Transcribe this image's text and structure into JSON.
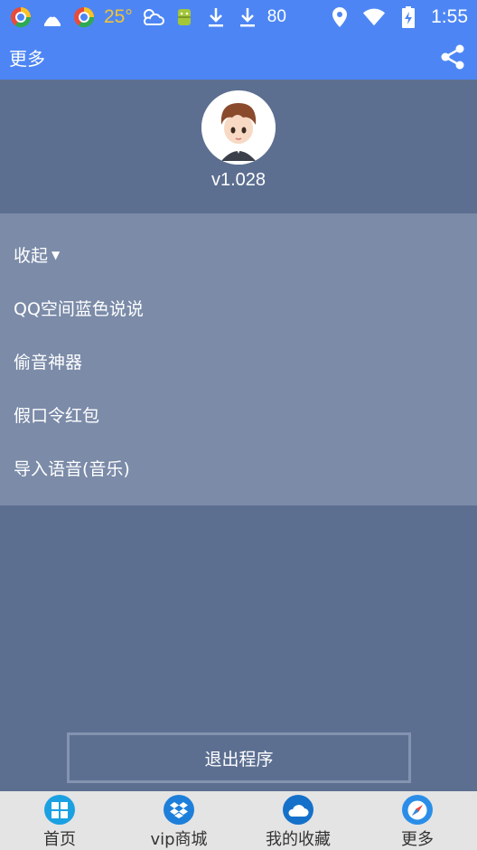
{
  "status_bar": {
    "temperature": "25°",
    "battery": "80",
    "time": "1:55"
  },
  "app_bar": {
    "title": "更多"
  },
  "profile": {
    "version": "v1.028"
  },
  "menu": {
    "items": [
      {
        "label": "收起",
        "caret": "▼"
      },
      {
        "label": "QQ空间蓝色说说"
      },
      {
        "label": "偷音神器"
      },
      {
        "label": "假口令红包"
      },
      {
        "label": "导入语音(音乐)"
      }
    ]
  },
  "exit_button": {
    "label": "退出程序"
  },
  "bottom_nav": {
    "items": [
      {
        "label": "首页",
        "icon": "windows-icon"
      },
      {
        "label": "vip商城",
        "icon": "dropbox-icon"
      },
      {
        "label": "我的收藏",
        "icon": "cloud-icon"
      },
      {
        "label": "更多",
        "icon": "compass-icon"
      }
    ]
  },
  "colors": {
    "primary": "#4d86f4",
    "background": "#5c6f91",
    "menu_panel": "#7b8ba8",
    "nav_background": "#e4e4e4"
  }
}
